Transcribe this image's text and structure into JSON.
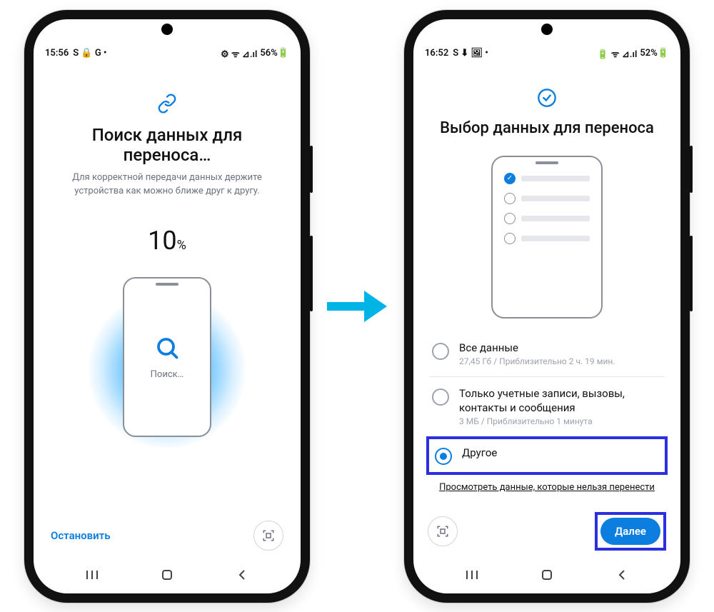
{
  "left": {
    "status": {
      "time": "15:56",
      "left_icons": "S 🔒 G •",
      "right_icons": "⚙ ᯤ ⊿.ıl",
      "battery": "56%🔋"
    },
    "title": "Поиск данных для переноса…",
    "subtitle": "Для корректной передачи данных держите устройства как можно ближе друг к другу.",
    "progress": {
      "value": "10",
      "unit": "%"
    },
    "searching_label": "Поиск…",
    "stop_label": "Остановить"
  },
  "right": {
    "status": {
      "time": "16:52",
      "left_icons": "S ⬇ 🖼 •",
      "right_icons": "🔋 ᯤ ⊿.ıl",
      "battery": "52%🔋"
    },
    "title": "Выбор данных для переноса",
    "options": [
      {
        "title": "Все данные",
        "sub": "27,45 Гб / Приблизительно 2 ч. 19 мин."
      },
      {
        "title": "Только учетные записи, вызовы, контакты и сообщения",
        "sub": "3 МБ / Приблизительно 1 минута"
      },
      {
        "title": "Другое",
        "selected": true
      }
    ],
    "non_transfer_link": "Просмотреть данные, которые нельзя перенести",
    "next_label": "Далее"
  }
}
